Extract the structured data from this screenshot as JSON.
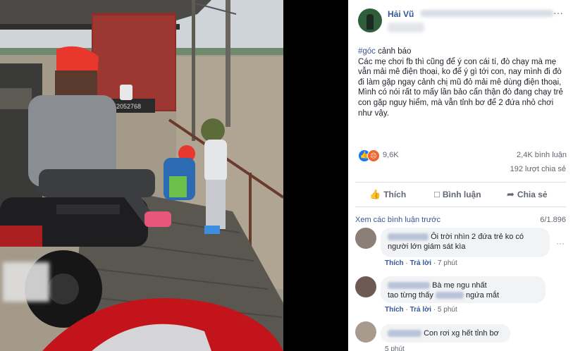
{
  "post": {
    "author": "Hải Vũ",
    "hashtag": "#góc",
    "hashtag_rest": " cảnh báo",
    "body": "Các mẹ chơi fb thì cũng để ý con cái tí, đò chạy mà mẹ vẫn mải mê điện thoại, ko để ý gì tới con, nay mình đi đò đi làm gặp ngay cảnh chị mũ đỏ mải mê dùng điện thoại, Mình có nói rất to mấy lần bảo cẩn thận đò đang chạy trẻ con gặp nguy hiểm, mà vẫn tỉnh bơ để 2 đứa nhỏ chơi như vậy.",
    "reactions_count": "9,6K",
    "comments_count": "2,4K bình luận",
    "shares_count": "192 lượt chia sẻ",
    "more_icon": "···"
  },
  "photo": {
    "plate": "52052768"
  },
  "actions": {
    "like": "Thích",
    "comment": "Bình luận",
    "share": "Chia sẻ"
  },
  "comments_header": {
    "previous": "Xem các bình luận trước",
    "count": "6/1.896"
  },
  "comments": [
    {
      "line1": "Ôi trời nhìn 2 đứa trẻ ko có",
      "line2": "người lớn giám sát kìa",
      "like": "Thích",
      "reply": "Trả lời",
      "time": "7 phút"
    },
    {
      "line1": "Bà mẹ ngu nhất",
      "line2a": "tao từng thấy",
      "line2b": "ngứa mắt",
      "like": "Thích",
      "reply": "Trả lời",
      "time": "5 phút"
    },
    {
      "line1": "Con rơi xg hết tỉnh bơ",
      "time": "5 phút"
    }
  ],
  "colors": {
    "link": "#365899",
    "like_blue": "#1877f2",
    "angry_orange": "#f0652f",
    "helmet_red": "#e8372c"
  }
}
